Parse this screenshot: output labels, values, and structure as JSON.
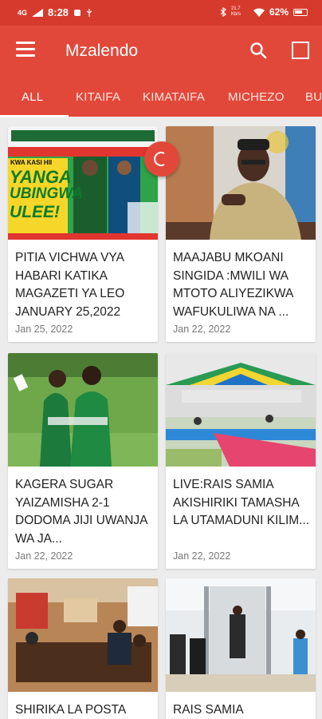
{
  "status": {
    "network": "4G",
    "time": "8:28",
    "speed": "21.7 Kb/s",
    "battery": "62%"
  },
  "appbar": {
    "title": "Mzalendo"
  },
  "tabs": [
    "ALL",
    "KITAIFA",
    "KIMATAIFA",
    "MICHEZO",
    "BU"
  ],
  "newspaper": {
    "headline1": "YANGA",
    "headline2": "UBINGWA",
    "headline3": "ULEE!",
    "kicker": "KWA KASI HII"
  },
  "articles": [
    {
      "title": "PITIA VICHWA VYA HABARI KATIKA MAGAZETI YA LEO JANUARY 25,2022",
      "date": "Jan 25, 2022"
    },
    {
      "title": "MAAJABU MKOANI SINGIDA :MWILI WA MTOTO ALIYEZIKWA WAFUKULIWA NA ...",
      "date": "Jan 22, 2022"
    },
    {
      "title": "KAGERA SUGAR YAIZAMISHA 2-1 DODOMA JIJI UWANJA WA JA...",
      "date": "Jan 22, 2022"
    },
    {
      "title": "LIVE:RAIS SAMIA AKISHIRIKI TAMASHA LA UTAMADUNI KILIM...",
      "date": "Jan 22, 2022"
    },
    {
      "title": "SHIRIKA LA POSTA",
      "date": ""
    },
    {
      "title": "RAIS SAMIA",
      "date": ""
    }
  ]
}
